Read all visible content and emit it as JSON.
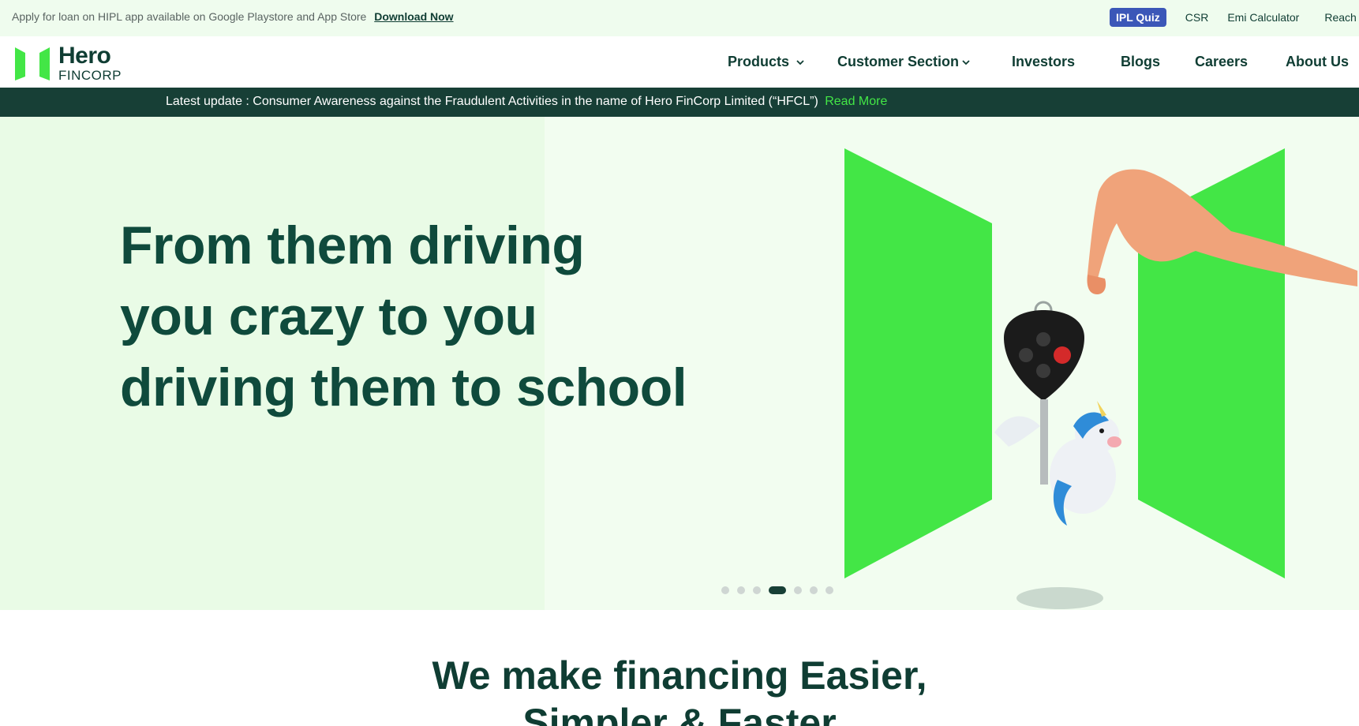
{
  "topbar": {
    "promo_text": "Apply for loan on HIPL app available on Google Playstore and App Store",
    "download_link": "Download Now",
    "links": [
      "IPL Quiz",
      "CSR",
      "Emi Calculator",
      "Reach"
    ]
  },
  "logo": {
    "brand_line1": "Hero",
    "brand_line2": "FINCORP"
  },
  "nav": {
    "products": "Products",
    "customer_section": "Customer Section",
    "investors": "Investors",
    "blogs": "Blogs",
    "careers": "Careers",
    "about_us": "About Us"
  },
  "update": {
    "message": "Latest update : Consumer Awareness against the Fraudulent Activities in the name of Hero FinCorp Limited (“HFCL”)",
    "read_more": "Read More"
  },
  "hero": {
    "headline_lines": [
      "From them driving",
      "you crazy to you",
      "driving them to school"
    ],
    "slide_count": 7,
    "active_slide": 4
  },
  "section": {
    "title_line1": "We make financing Easier,",
    "title_line2": "Simpler & Faster"
  },
  "colors": {
    "brand_dark": "#0f3d33",
    "brand_green": "#43e646",
    "ipl_blue": "#3b57b8",
    "hero_bg": "#e9fbe6"
  }
}
